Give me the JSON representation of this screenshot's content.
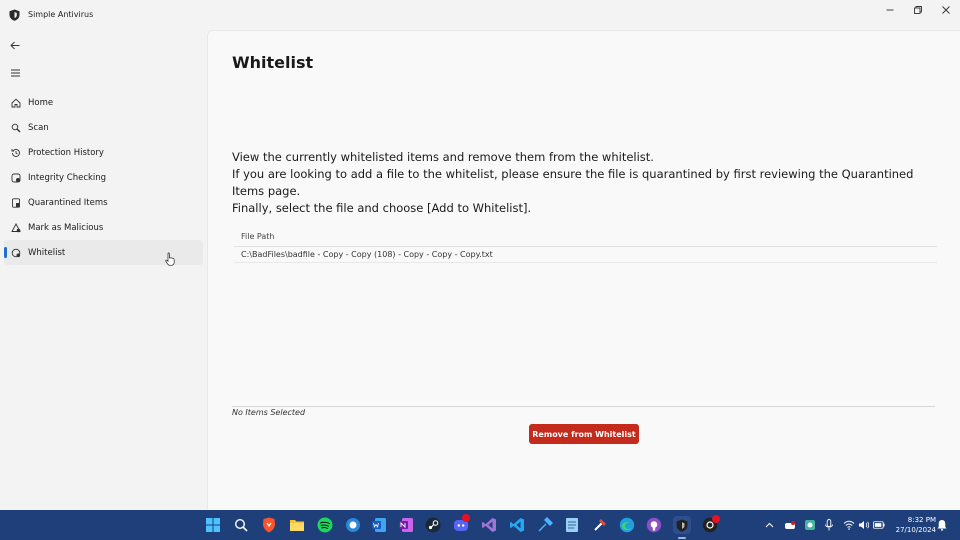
{
  "window": {
    "title": "Simple Antivirus"
  },
  "sidebar": {
    "items": [
      {
        "label": "Home",
        "icon": "home-icon"
      },
      {
        "label": "Scan",
        "icon": "scan-icon"
      },
      {
        "label": "Protection History",
        "icon": "history-icon"
      },
      {
        "label": "Integrity Checking",
        "icon": "integrity-icon"
      },
      {
        "label": "Quarantined Items",
        "icon": "quarantine-icon"
      },
      {
        "label": "Mark as Malicious",
        "icon": "malicious-icon"
      },
      {
        "label": "Whitelist",
        "icon": "whitelist-icon",
        "selected": true
      }
    ]
  },
  "main": {
    "title": "Whitelist",
    "description": {
      "line1": "View the currently whitelisted items and remove them from the whitelist.",
      "line2": "If you are looking to add a file to the whitelist, please ensure the file is quarantined by first reviewing the Quarantined Items page.",
      "line3": "Finally, select the file and choose [Add to Whitelist]."
    },
    "table": {
      "column_header": "File Path",
      "rows": [
        "C:\\BadFiles\\badfile - Copy - Copy (108) - Copy - Copy - Copy.txt"
      ]
    },
    "status": "No Items Selected",
    "remove_button": "Remove from Whitelist"
  },
  "colors": {
    "accent": "#1f6fd1",
    "danger": "#c42b1c",
    "taskbar": "#1f3f7a"
  },
  "taskbar": {
    "time": "8:32 PM",
    "date": "27/10/2024",
    "notification_badge": "99+"
  }
}
